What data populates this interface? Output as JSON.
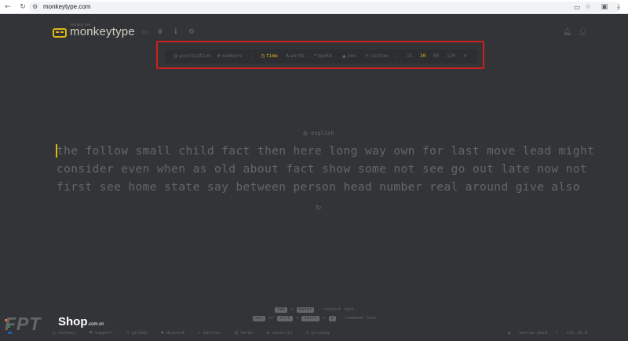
{
  "browser": {
    "url": "monkeytype.com",
    "icons": {
      "back": "arrow-left-icon",
      "forward": "arrow-right-icon",
      "reload": "reload-icon",
      "site_info": "tune-icon",
      "cast": "cast-icon",
      "bookmark": "star-icon",
      "extensions": "puzzle-icon",
      "download": "download-icon"
    }
  },
  "header": {
    "logo_small": "monkey see",
    "logo_text": "monkeytype",
    "nav_icons": [
      "keyboard-icon",
      "crown-icon",
      "info-icon",
      "gear-icon"
    ],
    "right_icons": [
      "bell-icon",
      "user-icon"
    ]
  },
  "config": {
    "punctuation": "punctuation",
    "numbers": "numbers",
    "time": "time",
    "words": "words",
    "quote": "quote",
    "zen": "zen",
    "custom": "custom",
    "durations": [
      "15",
      "30",
      "60",
      "120"
    ],
    "active_mode": "time",
    "active_duration": "30",
    "accent_color": "#e2b714"
  },
  "test": {
    "language": "english",
    "lines": [
      "the follow small child fact then here long way own for last move lead might",
      "consider even when as old about fact show some not see go out late now not",
      "first see home state say between person head number real around give also"
    ]
  },
  "hints": {
    "restart": [
      "tab",
      "+",
      "enter",
      "- restart test"
    ],
    "command": [
      "esc",
      "or",
      "ctrl",
      "+",
      "shift",
      "+",
      "p",
      "- command line"
    ]
  },
  "footer": {
    "left": [
      "contact",
      "support",
      "github",
      "discord",
      "twitter",
      "terms",
      "security",
      "privacy"
    ],
    "theme": "serika dark",
    "version": "v25.10.0"
  },
  "watermark": {
    "brand": "FPT",
    "shop": "Shop",
    "domain": ".com.vn"
  }
}
